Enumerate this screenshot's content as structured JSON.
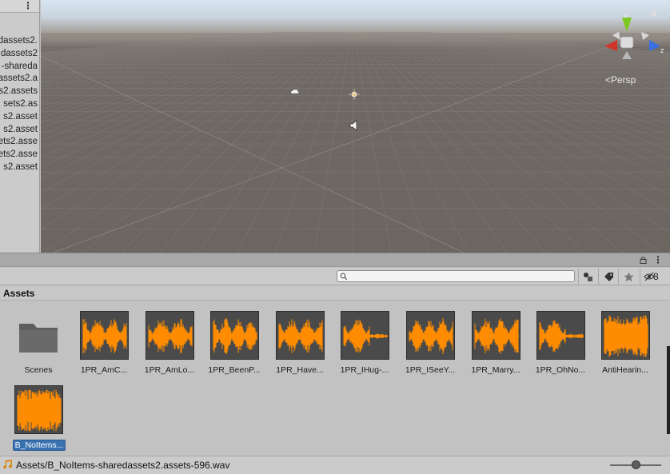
{
  "hierarchy": {
    "rows": [
      "dassets2.",
      "dassets2",
      "-shareda",
      "assets2.a",
      "ssets2.assets",
      "sets2.as",
      "s2.asset",
      "s2.asset",
      "ets2.asse",
      "ets2.asse",
      "s2.asset"
    ]
  },
  "scene": {
    "persp_label": "<Persp",
    "gizmo": {
      "y_label": "y",
      "x_label": "x",
      "z_label": "z"
    },
    "colors": {
      "x_axis": "#d0352c",
      "y_axis": "#7cc81e",
      "z_axis": "#3a6fe0",
      "sky": "#d7e5f2",
      "ground": "#6c6661"
    }
  },
  "project": {
    "hidden_count": "8",
    "breadcrumb": "Assets",
    "search_placeholder": "",
    "items": [
      {
        "label": "Scenes",
        "kind": "folder"
      },
      {
        "label": "1PR_AmC...",
        "kind": "audio"
      },
      {
        "label": "1PR_AmLo...",
        "kind": "audio"
      },
      {
        "label": "1PR_BeenP...",
        "kind": "audio"
      },
      {
        "label": "1PR_Have...",
        "kind": "audio"
      },
      {
        "label": "1PR_IHug-...",
        "kind": "audio"
      },
      {
        "label": "1PR_ISeeY...",
        "kind": "audio"
      },
      {
        "label": "1PR_Marry...",
        "kind": "audio"
      },
      {
        "label": "1PR_OhNo...",
        "kind": "audio"
      },
      {
        "label": "AntiHearin...",
        "kind": "audio"
      },
      {
        "label": "B_NoItems...",
        "kind": "audio",
        "selected": true
      }
    ],
    "status_path": "Assets/B_NoItems-sharedassets2.assets-596.wav",
    "zoom_level": 0.5,
    "waveform_color": "#ff8c00"
  }
}
